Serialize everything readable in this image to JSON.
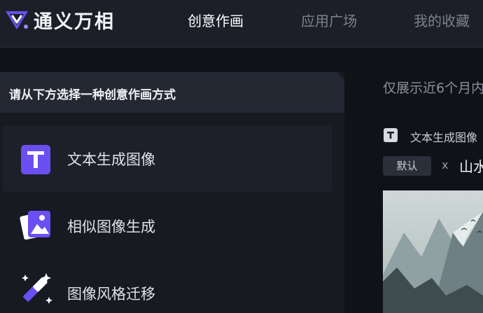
{
  "header": {
    "brand": "通义万相",
    "nav": [
      {
        "label": "创意作画",
        "active": true
      },
      {
        "label": "应用广场",
        "active": false
      },
      {
        "label": "我的收藏",
        "active": false
      }
    ]
  },
  "panel": {
    "title": "请从下方选择一种创意作画方式",
    "options": [
      {
        "label": "文本生成图像",
        "icon": "text-t-icon",
        "selected": true
      },
      {
        "label": "相似图像生成",
        "icon": "image-stack-icon",
        "selected": false
      },
      {
        "label": "图像风格迁移",
        "icon": "magic-wand-icon",
        "selected": false
      }
    ]
  },
  "right": {
    "notice": "仅展示近6个月内",
    "task": {
      "title": "文本生成图像",
      "tag": "默认",
      "separator": "x",
      "style": "山水"
    }
  },
  "colors": {
    "accent": "#6b4ff2",
    "header_bg": "#1c1f27",
    "page_bg": "#101218"
  }
}
